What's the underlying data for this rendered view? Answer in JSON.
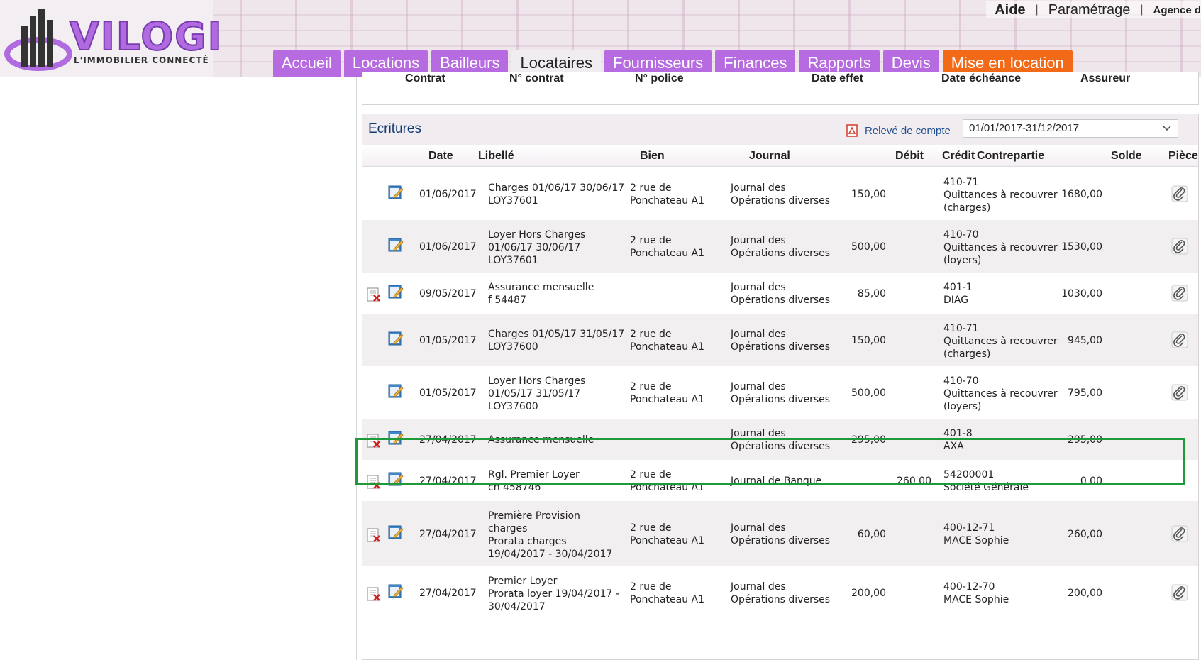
{
  "header": {
    "logo_text": "VILOGI",
    "logo_subtitle": "L'IMMOBILIER CONNECTÉ",
    "links": {
      "help": "Aide",
      "separator": "|",
      "settings": "Paramétrage",
      "agency": "Agence d"
    },
    "tabs": [
      {
        "label": "Accueil",
        "state": "normal"
      },
      {
        "label": "Locations",
        "state": "normal"
      },
      {
        "label": "Bailleurs",
        "state": "normal"
      },
      {
        "label": "Locataires",
        "state": "active"
      },
      {
        "label": "Fournisseurs",
        "state": "normal"
      },
      {
        "label": "Finances",
        "state": "normal"
      },
      {
        "label": "Rapports",
        "state": "normal"
      },
      {
        "label": "Devis",
        "state": "normal"
      },
      {
        "label": "Mise en location",
        "state": "highlight"
      }
    ]
  },
  "contract": {
    "headers": [
      "Contrat",
      "N° contrat",
      "N° police",
      "Date effet",
      "Date échéance",
      "Assureur"
    ]
  },
  "ecritures": {
    "title": "Ecritures",
    "releve_label": "Relevé de compte",
    "period": "01/01/2017-31/12/2017",
    "columns": {
      "date": "Date",
      "libelle": "Libellé",
      "bien": "Bien",
      "journal": "Journal",
      "debit": "Débit",
      "credit": "Crédit",
      "contrepartie": "Contrepartie",
      "solde": "Solde",
      "piece": "Pièce"
    },
    "rows": [
      {
        "date": "01/06/2017",
        "libelle": "Charges 01/06/17 30/06/17\nLOY37601",
        "bien": "2 rue de\nPonchateau A1",
        "journal": "Journal des\nOpérations diverses",
        "debit": "150,00",
        "credit": "",
        "contrepartie": "410-71\nQuittances à recouvrer\n(charges)",
        "solde": "1680,00",
        "deletable": false,
        "attachment": true
      },
      {
        "date": "01/06/2017",
        "libelle": "Loyer Hors Charges\n01/06/17 30/06/17\nLOY37601",
        "bien": "2 rue de\nPonchateau A1",
        "journal": "Journal des\nOpérations diverses",
        "debit": "500,00",
        "credit": "",
        "contrepartie": "410-70\nQuittances à recouvrer\n(loyers)",
        "solde": "1530,00",
        "deletable": false,
        "attachment": true
      },
      {
        "date": "09/05/2017",
        "libelle": "Assurance mensuelle\nf 54487",
        "bien": "",
        "journal": "Journal des\nOpérations diverses",
        "debit": "85,00",
        "credit": "",
        "contrepartie": "401-1\nDIAG",
        "solde": "1030,00",
        "deletable": true,
        "attachment": true
      },
      {
        "date": "01/05/2017",
        "libelle": "Charges 01/05/17 31/05/17\nLOY37600",
        "bien": "2 rue de\nPonchateau A1",
        "journal": "Journal des\nOpérations diverses",
        "debit": "150,00",
        "credit": "",
        "contrepartie": "410-71\nQuittances à recouvrer\n(charges)",
        "solde": "945,00",
        "deletable": false,
        "attachment": true
      },
      {
        "date": "01/05/2017",
        "libelle": "Loyer Hors Charges\n01/05/17 31/05/17\nLOY37600",
        "bien": "2 rue de\nPonchateau A1",
        "journal": "Journal des\nOpérations diverses",
        "debit": "500,00",
        "credit": "",
        "contrepartie": "410-70\nQuittances à recouvrer\n(loyers)",
        "solde": "795,00",
        "deletable": false,
        "attachment": true
      },
      {
        "date": "27/04/2017",
        "libelle": "Assurance mensuelle",
        "bien": "",
        "journal": "Journal des\nOpérations diverses",
        "debit": "295,00",
        "credit": "",
        "contrepartie": "401-8\nAXA",
        "solde": "295,00",
        "deletable": true,
        "attachment": false
      },
      {
        "date": "27/04/2017",
        "libelle": "Rgl. Premier Loyer\nch 458746",
        "bien": "2 rue de\nPonchateau A1",
        "journal": "Journal de Banque",
        "debit": "",
        "credit": "260,00",
        "contrepartie": "54200001\nSociété Générale",
        "solde": "0,00",
        "deletable": true,
        "attachment": false
      },
      {
        "date": "27/04/2017",
        "libelle": "Première Provision\ncharges\nProrata charges\n19/04/2017 - 30/04/2017",
        "bien": "2 rue de\nPonchateau A1",
        "journal": "Journal des\nOpérations diverses",
        "debit": "60,00",
        "credit": "",
        "contrepartie": "400-12-71\nMACE Sophie",
        "solde": "260,00",
        "deletable": true,
        "attachment": true
      },
      {
        "date": "27/04/2017",
        "libelle": "Premier Loyer\nProrata loyer 19/04/2017 -\n30/04/2017",
        "bien": "2 rue de\nPonchateau A1",
        "journal": "Journal des\nOpérations diverses",
        "debit": "200,00",
        "credit": "",
        "contrepartie": "400-12-70\nMACE Sophie",
        "solde": "200,00",
        "deletable": true,
        "attachment": true
      }
    ]
  },
  "colors": {
    "tab": "#b76be0",
    "tab_highlight": "#f26a17",
    "title_blue": "#123a73",
    "highlight_green": "#1e9a3a"
  }
}
